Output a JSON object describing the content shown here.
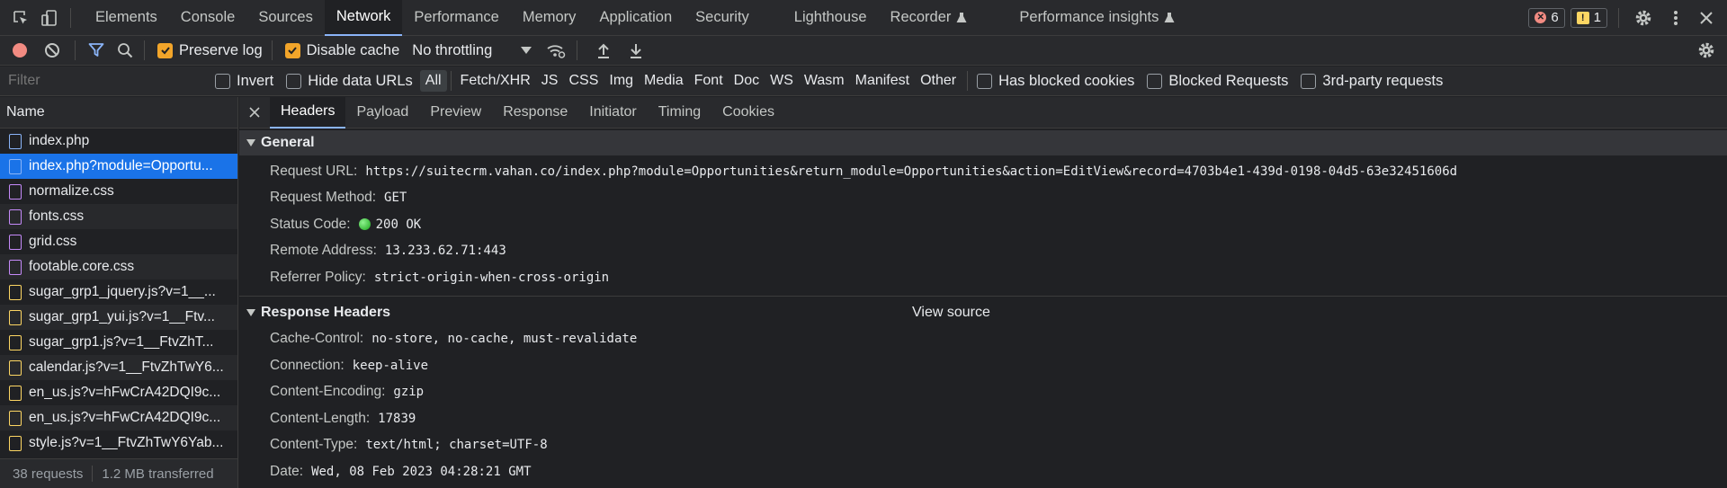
{
  "topbar": {
    "tabs": [
      "Elements",
      "Console",
      "Sources",
      "Network",
      "Performance",
      "Memory",
      "Application",
      "Security",
      "Lighthouse",
      "Recorder",
      "Performance insights"
    ],
    "active_tab": "Network",
    "error_count": "6",
    "warning_count": "1"
  },
  "toolbar": {
    "preserve_log_label": "Preserve log",
    "disable_cache_label": "Disable cache",
    "throttling_value": "No throttling"
  },
  "filterbar": {
    "filter_placeholder": "Filter",
    "invert_label": "Invert",
    "hide_data_urls_label": "Hide data URLs",
    "types": [
      "All",
      "Fetch/XHR",
      "JS",
      "CSS",
      "Img",
      "Media",
      "Font",
      "Doc",
      "WS",
      "Wasm",
      "Manifest",
      "Other"
    ],
    "has_blocked_cookies_label": "Has blocked cookies",
    "blocked_requests_label": "Blocked Requests",
    "third_party_label": "3rd-party requests"
  },
  "requests": {
    "column_header": "Name",
    "items": [
      {
        "name": "index.php",
        "type": "doc"
      },
      {
        "name": "index.php?module=Opportu...",
        "type": "doc"
      },
      {
        "name": "normalize.css",
        "type": "css"
      },
      {
        "name": "fonts.css",
        "type": "css"
      },
      {
        "name": "grid.css",
        "type": "css"
      },
      {
        "name": "footable.core.css",
        "type": "css"
      },
      {
        "name": "sugar_grp1_jquery.js?v=1__...",
        "type": "js"
      },
      {
        "name": "sugar_grp1_yui.js?v=1__Ftv...",
        "type": "js"
      },
      {
        "name": "sugar_grp1.js?v=1__FtvZhT...",
        "type": "js"
      },
      {
        "name": "calendar.js?v=1__FtvZhTwY6...",
        "type": "js"
      },
      {
        "name": "en_us.js?v=hFwCrA42DQI9c...",
        "type": "js"
      },
      {
        "name": "en_us.js?v=hFwCrA42DQI9c...",
        "type": "js"
      },
      {
        "name": "style.js?v=1__FtvZhTwY6Yab...",
        "type": "js"
      }
    ],
    "selected_index": 1,
    "status_requests": "38 requests",
    "status_transferred": "1.2 MB transferred"
  },
  "details": {
    "tabs": [
      "Headers",
      "Payload",
      "Preview",
      "Response",
      "Initiator",
      "Timing",
      "Cookies"
    ],
    "active_tab": "Headers",
    "general": {
      "title": "General",
      "rows": [
        {
          "key": "Request URL:",
          "value": "https://suitecrm.vahan.co/index.php?module=Opportunities&return_module=Opportunities&action=EditView&record=4703b4e1-439d-0198-04d5-63e32451606d"
        },
        {
          "key": "Request Method:",
          "value": "GET"
        },
        {
          "key": "Status Code:",
          "value": "200 OK"
        },
        {
          "key": "Remote Address:",
          "value": "13.233.62.71:443"
        },
        {
          "key": "Referrer Policy:",
          "value": "strict-origin-when-cross-origin"
        }
      ]
    },
    "response_headers": {
      "title": "Response Headers",
      "view_source_label": "View source",
      "rows": [
        {
          "key": "Cache-Control:",
          "value": "no-store, no-cache, must-revalidate"
        },
        {
          "key": "Connection:",
          "value": "keep-alive"
        },
        {
          "key": "Content-Encoding:",
          "value": "gzip"
        },
        {
          "key": "Content-Length:",
          "value": "17839"
        },
        {
          "key": "Content-Type:",
          "value": "text/html; charset=UTF-8"
        },
        {
          "key": "Date:",
          "value": "Wed, 08 Feb 2023 04:28:21 GMT"
        }
      ]
    }
  }
}
